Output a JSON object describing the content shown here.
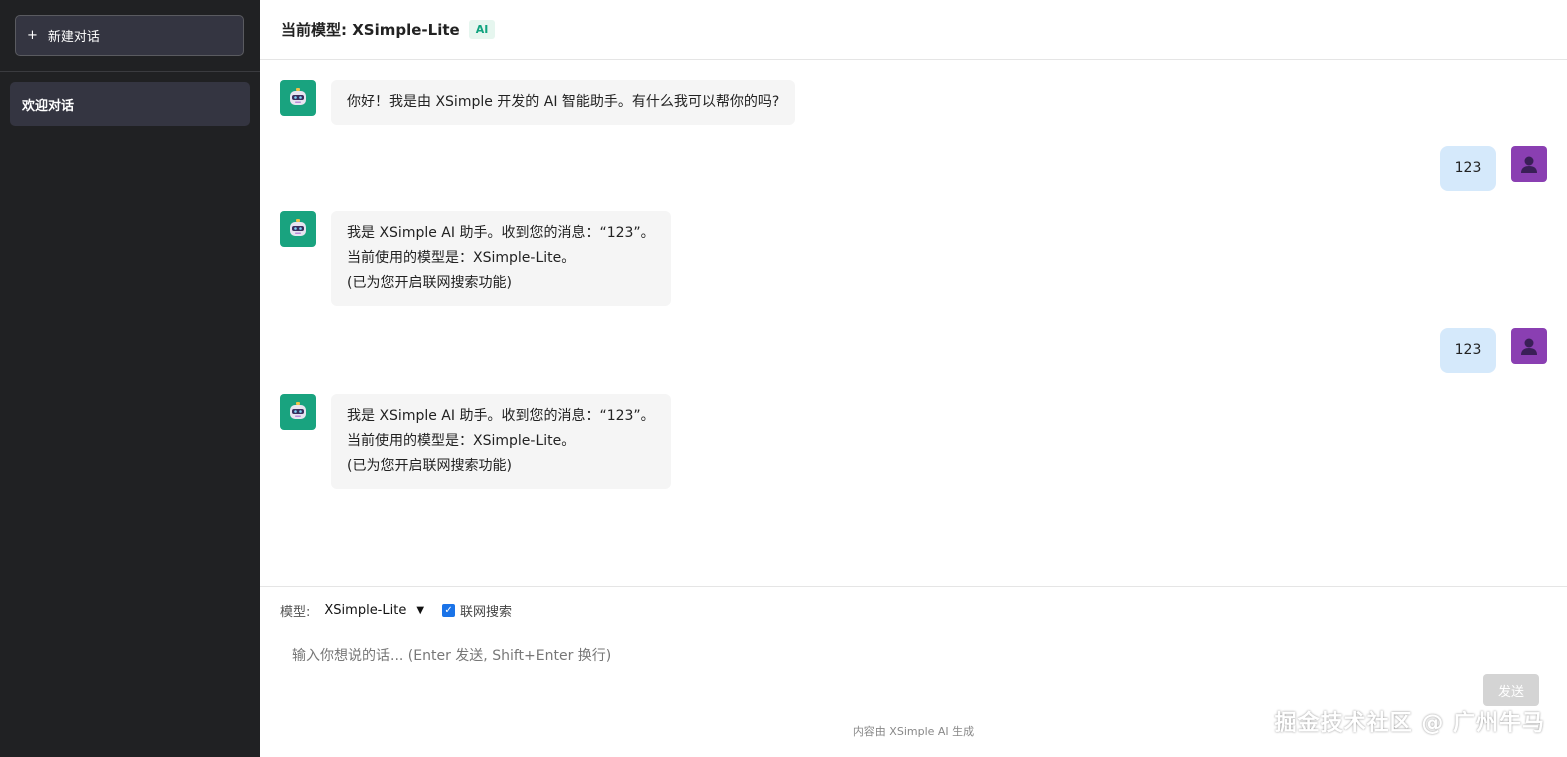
{
  "sidebar": {
    "new_chat_icon": "+",
    "new_chat_label": "新建对话",
    "conversations": [
      {
        "title": "欢迎对话"
      }
    ]
  },
  "header": {
    "title": "当前模型: XSimple-Lite",
    "badge": "AI"
  },
  "messages": [
    {
      "role": "assistant",
      "avatar": "robot-icon",
      "lines": [
        "你好！我是由 XSimple 开发的 AI 智能助手。有什么我可以帮你的吗?"
      ]
    },
    {
      "role": "user",
      "avatar": "user-icon",
      "lines": [
        "123"
      ]
    },
    {
      "role": "assistant",
      "avatar": "robot-icon",
      "lines": [
        "我是 XSimple AI 助手。收到您的消息：“123”。",
        "当前使用的模型是：XSimple-Lite。",
        "(已为您开启联网搜索功能)"
      ]
    },
    {
      "role": "user",
      "avatar": "user-icon",
      "lines": [
        "123"
      ]
    },
    {
      "role": "assistant",
      "avatar": "robot-icon",
      "lines": [
        "我是 XSimple AI 助手。收到您的消息：“123”。",
        "当前使用的模型是：XSimple-Lite。",
        "(已为您开启联网搜索功能)"
      ]
    }
  ],
  "input": {
    "model_label": "模型:",
    "model_selected": "XSimple-Lite",
    "web_search_label": "联网搜索",
    "web_search_checked": true,
    "placeholder": "输入你想说的话... (Enter 发送, Shift+Enter 换行)",
    "send_label": "发送",
    "footer_note": "内容由 XSimple AI 生成"
  },
  "watermark": "掘金技术社区 @ 广州牛马",
  "colors": {
    "sidebar_bg": "#202123",
    "bot_avatar": "#19a37f",
    "user_avatar": "#8a3fb2",
    "user_bubble": "#d5e9fb",
    "bot_bubble": "#f5f5f5",
    "accent": "#10a37f"
  }
}
